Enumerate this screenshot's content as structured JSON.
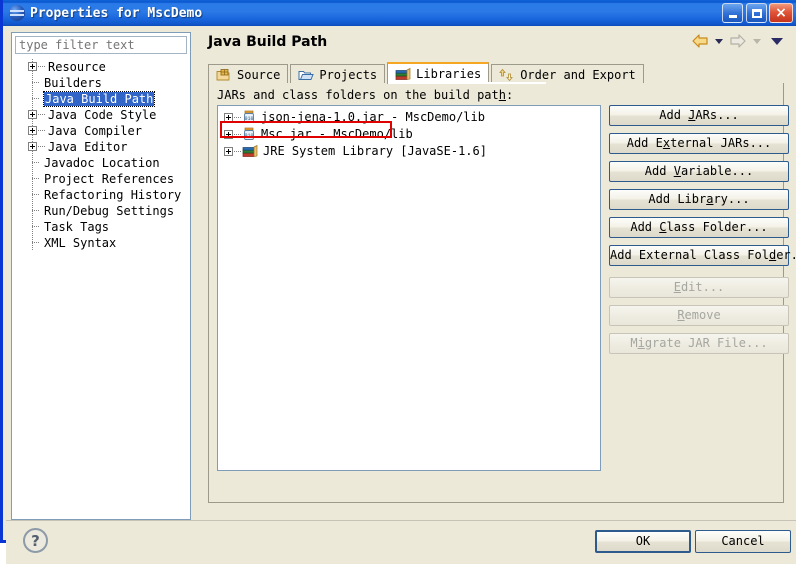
{
  "window": {
    "title": "Properties for MscDemo",
    "app_icon": "eclipse-globe-icon",
    "buttons": {
      "minimize": "minimize-icon",
      "maximize": "maximize-icon",
      "close": "×"
    }
  },
  "sidebar": {
    "filter": {
      "value": "",
      "placeholder": "type filter text"
    },
    "items": [
      {
        "label": "Resource",
        "expandable": true,
        "selected": false
      },
      {
        "label": "Builders",
        "expandable": false,
        "selected": false
      },
      {
        "label": "Java Build Path",
        "expandable": false,
        "selected": true
      },
      {
        "label": "Java Code Style",
        "expandable": true,
        "selected": false
      },
      {
        "label": "Java Compiler",
        "expandable": true,
        "selected": false
      },
      {
        "label": "Java Editor",
        "expandable": true,
        "selected": false
      },
      {
        "label": "Javadoc Location",
        "expandable": false,
        "selected": false
      },
      {
        "label": "Project References",
        "expandable": false,
        "selected": false
      },
      {
        "label": "Refactoring History",
        "expandable": false,
        "selected": false
      },
      {
        "label": "Run/Debug Settings",
        "expandable": false,
        "selected": false
      },
      {
        "label": "Task Tags",
        "expandable": false,
        "selected": false
      },
      {
        "label": "XML Syntax",
        "expandable": false,
        "selected": false
      }
    ]
  },
  "page": {
    "title": "Java Build Path",
    "nav": {
      "back": "back-arrow-icon",
      "back_enabled": true,
      "forward": "forward-arrow-icon",
      "forward_enabled": false,
      "menu": "view-menu-icon"
    }
  },
  "tabs": [
    {
      "label": "Source",
      "icon": "source-folder-icon",
      "active": false
    },
    {
      "label": "Projects",
      "icon": "projects-folder-icon",
      "active": false
    },
    {
      "label": "Libraries",
      "icon": "libraries-books-icon",
      "active": true
    },
    {
      "label": "Order and Export",
      "icon": "order-export-icon",
      "active": false
    }
  ],
  "libraries": {
    "caption_before": "JARs and class folders on the build pat",
    "caption_mnemonic": "h",
    "caption_after": ":",
    "entries": [
      {
        "label": "json-jena-1.0.jar - MscDemo/lib",
        "icon": "jar-icon",
        "highlighted": false
      },
      {
        "label": "Msc.jar - MscDemo/lib",
        "icon": "jar-icon",
        "highlighted": true
      },
      {
        "label": "JRE System Library [JavaSE-1.6]",
        "icon": "books-icon",
        "highlighted": false
      }
    ],
    "highlight_color": "#e00000"
  },
  "side_buttons": [
    {
      "pre": "Add ",
      "mnemonic": "J",
      "post": "ARs...",
      "enabled": true,
      "gap": false
    },
    {
      "pre": "Add E",
      "mnemonic": "x",
      "post": "ternal JARs...",
      "enabled": true,
      "gap": false
    },
    {
      "pre": "Add ",
      "mnemonic": "V",
      "post": "ariable...",
      "enabled": true,
      "gap": false
    },
    {
      "pre": "Add Libr",
      "mnemonic": "a",
      "post": "ry...",
      "enabled": true,
      "gap": false
    },
    {
      "pre": "Add ",
      "mnemonic": "C",
      "post": "lass Folder...",
      "enabled": true,
      "gap": false
    },
    {
      "pre": "Add External Class Fol",
      "mnemonic": "d",
      "post": "er...",
      "enabled": true,
      "gap": false
    },
    {
      "pre": "",
      "mnemonic": "E",
      "post": "dit...",
      "enabled": false,
      "gap": true
    },
    {
      "pre": "",
      "mnemonic": "R",
      "post": "emove",
      "enabled": false,
      "gap": false
    },
    {
      "pre": "M",
      "mnemonic": "i",
      "post": "grate JAR File...",
      "enabled": false,
      "gap": false
    }
  ],
  "footer": {
    "help_icon": "help-question-icon",
    "help_glyph": "?",
    "ok_label": "OK",
    "cancel_label": "Cancel"
  },
  "colors": {
    "title_bar": "#2a79e6",
    "dialog_bg": "#ece9d8",
    "selection": "#3165c8",
    "tab_active_accent": "#f5a623",
    "annotation_red": "#e00000",
    "window_border": "#0a36d4"
  }
}
